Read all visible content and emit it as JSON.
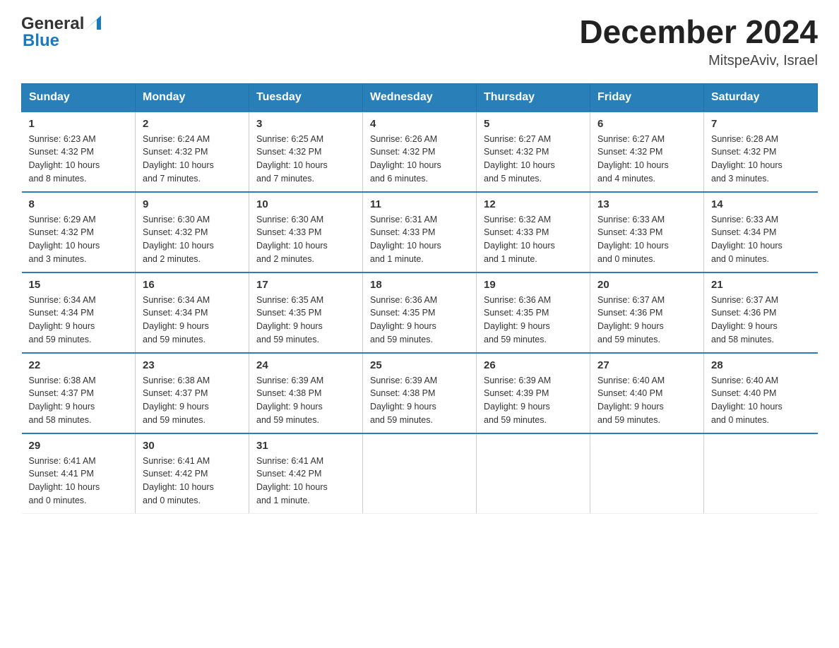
{
  "header": {
    "logo_general": "General",
    "logo_blue": "Blue",
    "month_title": "December 2024",
    "subtitle": "MitspeAviv, Israel"
  },
  "days_of_week": [
    "Sunday",
    "Monday",
    "Tuesday",
    "Wednesday",
    "Thursday",
    "Friday",
    "Saturday"
  ],
  "weeks": [
    [
      {
        "num": "1",
        "sunrise": "6:23 AM",
        "sunset": "4:32 PM",
        "daylight": "10 hours and 8 minutes."
      },
      {
        "num": "2",
        "sunrise": "6:24 AM",
        "sunset": "4:32 PM",
        "daylight": "10 hours and 7 minutes."
      },
      {
        "num": "3",
        "sunrise": "6:25 AM",
        "sunset": "4:32 PM",
        "daylight": "10 hours and 7 minutes."
      },
      {
        "num": "4",
        "sunrise": "6:26 AM",
        "sunset": "4:32 PM",
        "daylight": "10 hours and 6 minutes."
      },
      {
        "num": "5",
        "sunrise": "6:27 AM",
        "sunset": "4:32 PM",
        "daylight": "10 hours and 5 minutes."
      },
      {
        "num": "6",
        "sunrise": "6:27 AM",
        "sunset": "4:32 PM",
        "daylight": "10 hours and 4 minutes."
      },
      {
        "num": "7",
        "sunrise": "6:28 AM",
        "sunset": "4:32 PM",
        "daylight": "10 hours and 3 minutes."
      }
    ],
    [
      {
        "num": "8",
        "sunrise": "6:29 AM",
        "sunset": "4:32 PM",
        "daylight": "10 hours and 3 minutes."
      },
      {
        "num": "9",
        "sunrise": "6:30 AM",
        "sunset": "4:32 PM",
        "daylight": "10 hours and 2 minutes."
      },
      {
        "num": "10",
        "sunrise": "6:30 AM",
        "sunset": "4:33 PM",
        "daylight": "10 hours and 2 minutes."
      },
      {
        "num": "11",
        "sunrise": "6:31 AM",
        "sunset": "4:33 PM",
        "daylight": "10 hours and 1 minute."
      },
      {
        "num": "12",
        "sunrise": "6:32 AM",
        "sunset": "4:33 PM",
        "daylight": "10 hours and 1 minute."
      },
      {
        "num": "13",
        "sunrise": "6:33 AM",
        "sunset": "4:33 PM",
        "daylight": "10 hours and 0 minutes."
      },
      {
        "num": "14",
        "sunrise": "6:33 AM",
        "sunset": "4:34 PM",
        "daylight": "10 hours and 0 minutes."
      }
    ],
    [
      {
        "num": "15",
        "sunrise": "6:34 AM",
        "sunset": "4:34 PM",
        "daylight": "9 hours and 59 minutes."
      },
      {
        "num": "16",
        "sunrise": "6:34 AM",
        "sunset": "4:34 PM",
        "daylight": "9 hours and 59 minutes."
      },
      {
        "num": "17",
        "sunrise": "6:35 AM",
        "sunset": "4:35 PM",
        "daylight": "9 hours and 59 minutes."
      },
      {
        "num": "18",
        "sunrise": "6:36 AM",
        "sunset": "4:35 PM",
        "daylight": "9 hours and 59 minutes."
      },
      {
        "num": "19",
        "sunrise": "6:36 AM",
        "sunset": "4:35 PM",
        "daylight": "9 hours and 59 minutes."
      },
      {
        "num": "20",
        "sunrise": "6:37 AM",
        "sunset": "4:36 PM",
        "daylight": "9 hours and 59 minutes."
      },
      {
        "num": "21",
        "sunrise": "6:37 AM",
        "sunset": "4:36 PM",
        "daylight": "9 hours and 58 minutes."
      }
    ],
    [
      {
        "num": "22",
        "sunrise": "6:38 AM",
        "sunset": "4:37 PM",
        "daylight": "9 hours and 58 minutes."
      },
      {
        "num": "23",
        "sunrise": "6:38 AM",
        "sunset": "4:37 PM",
        "daylight": "9 hours and 59 minutes."
      },
      {
        "num": "24",
        "sunrise": "6:39 AM",
        "sunset": "4:38 PM",
        "daylight": "9 hours and 59 minutes."
      },
      {
        "num": "25",
        "sunrise": "6:39 AM",
        "sunset": "4:38 PM",
        "daylight": "9 hours and 59 minutes."
      },
      {
        "num": "26",
        "sunrise": "6:39 AM",
        "sunset": "4:39 PM",
        "daylight": "9 hours and 59 minutes."
      },
      {
        "num": "27",
        "sunrise": "6:40 AM",
        "sunset": "4:40 PM",
        "daylight": "9 hours and 59 minutes."
      },
      {
        "num": "28",
        "sunrise": "6:40 AM",
        "sunset": "4:40 PM",
        "daylight": "10 hours and 0 minutes."
      }
    ],
    [
      {
        "num": "29",
        "sunrise": "6:41 AM",
        "sunset": "4:41 PM",
        "daylight": "10 hours and 0 minutes."
      },
      {
        "num": "30",
        "sunrise": "6:41 AM",
        "sunset": "4:42 PM",
        "daylight": "10 hours and 0 minutes."
      },
      {
        "num": "31",
        "sunrise": "6:41 AM",
        "sunset": "4:42 PM",
        "daylight": "10 hours and 1 minute."
      },
      null,
      null,
      null,
      null
    ]
  ]
}
